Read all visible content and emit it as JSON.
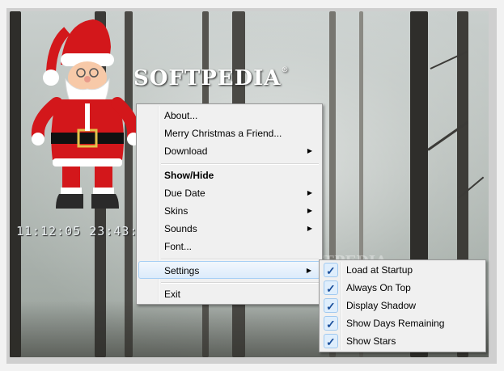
{
  "logo": {
    "text": "SOFTPEDIA",
    "reg": "®"
  },
  "clock": {
    "text": "11:12:05 23:43:43"
  },
  "watermark": {
    "text": "SOFTPEDIA"
  },
  "menu": {
    "items": [
      {
        "label": "About..."
      },
      {
        "label": "Merry Christmas a Friend..."
      },
      {
        "label": "Download",
        "arrow": "▶"
      },
      {
        "label": "Show/Hide"
      },
      {
        "label": "Due Date",
        "arrow": "▶"
      },
      {
        "label": "Skins",
        "arrow": "▶"
      },
      {
        "label": "Sounds",
        "arrow": "▶"
      },
      {
        "label": "Font..."
      },
      {
        "label": "Settings",
        "arrow": "▶"
      },
      {
        "label": "Exit"
      }
    ]
  },
  "submenu": {
    "check_glyph": "✓",
    "items": [
      {
        "label": "Load at Startup"
      },
      {
        "label": "Always On Top"
      },
      {
        "label": "Display Shadow"
      },
      {
        "label": "Show Days Remaining"
      },
      {
        "label": "Show Stars"
      }
    ]
  },
  "colors": {
    "menu_bg": "#f0f0f0",
    "highlight_border": "#a8d0f5",
    "check_color": "#1b4f9b",
    "santa_red": "#d3171b"
  }
}
